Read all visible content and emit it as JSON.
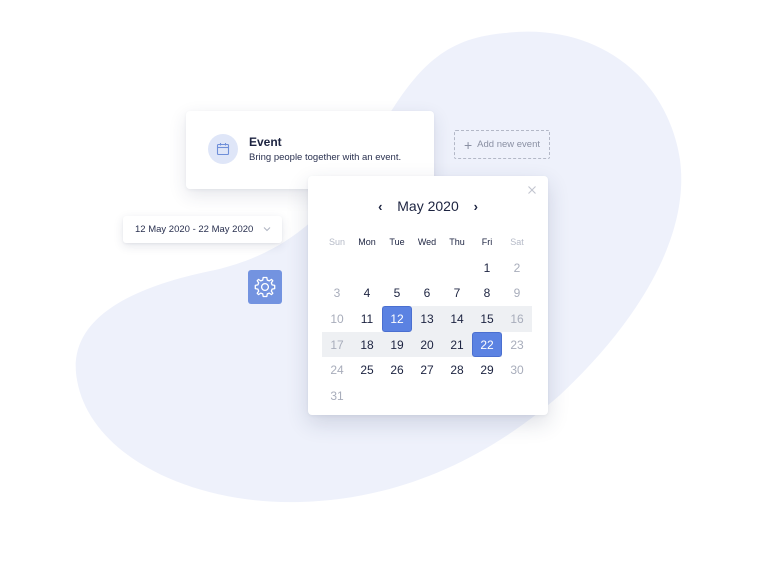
{
  "colors": {
    "accent": "#5b82e2",
    "blob": "#eef1fb",
    "range": "#eef0f3",
    "settings_bg": "#7393e0"
  },
  "event_card": {
    "icon": "calendar-icon",
    "title": "Event",
    "description": "Bring people together with an event."
  },
  "add_event": {
    "icon": "plus-icon",
    "label": "Add new event"
  },
  "date_select": {
    "value": "12 May 2020 - 22 May 2020",
    "icon": "chevron-down-icon"
  },
  "settings": {
    "icon": "gear-icon"
  },
  "calendar": {
    "month_label": "May 2020",
    "prev_icon": "chevron-left-icon",
    "next_icon": "chevron-right-icon",
    "close_icon": "close-icon",
    "weekdays": [
      "Sun",
      "Mon",
      "Tue",
      "Wed",
      "Thu",
      "Fri",
      "Sat"
    ],
    "weeks": [
      [
        "",
        "",
        "",
        "",
        "",
        "1",
        "2"
      ],
      [
        "3",
        "4",
        "5",
        "6",
        "7",
        "8",
        "9"
      ],
      [
        "10",
        "11",
        "12",
        "13",
        "14",
        "15",
        "16"
      ],
      [
        "17",
        "18",
        "19",
        "20",
        "21",
        "22",
        "23"
      ],
      [
        "24",
        "25",
        "26",
        "27",
        "28",
        "29",
        "30"
      ],
      [
        "31",
        "",
        "",
        "",
        "",
        "",
        ""
      ]
    ],
    "selected_start": "12",
    "selected_end": "22"
  }
}
